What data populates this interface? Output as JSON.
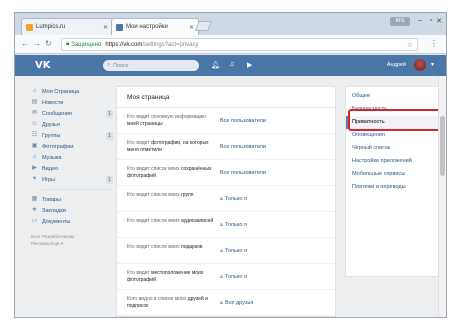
{
  "browser": {
    "tabs": [
      {
        "label": "Lumpics.ru",
        "favicon_color": "#f4a52a"
      },
      {
        "label": "Мои настройки",
        "favicon_color": "#4a76a8"
      }
    ],
    "profile_chip": "ATE",
    "address": {
      "secure_label": "Защищено",
      "host": "https://vk.com",
      "path": "/settings?act=privacy"
    }
  },
  "vk": {
    "logo": "VK",
    "search_placeholder": "Поиск",
    "user_name": "Андрей",
    "accent_color": "#4a76a8"
  },
  "sidebar": {
    "items": [
      {
        "label": "Моя Страница",
        "icon": "home-icon",
        "glyph": "⌂",
        "badge": ""
      },
      {
        "label": "Новости",
        "icon": "news-icon",
        "glyph": "▤",
        "badge": ""
      },
      {
        "label": "Сообщения",
        "icon": "messages-icon",
        "glyph": "✉",
        "badge": "1"
      },
      {
        "label": "Друзья",
        "icon": "friends-icon",
        "glyph": "☺",
        "badge": ""
      },
      {
        "label": "Группы",
        "icon": "groups-icon",
        "glyph": "☷",
        "badge": "1"
      },
      {
        "label": "Фотографии",
        "icon": "photos-icon",
        "glyph": "▣",
        "badge": ""
      },
      {
        "label": "Музыка",
        "icon": "music-icon",
        "glyph": "♫",
        "badge": ""
      },
      {
        "label": "Видео",
        "icon": "video-icon",
        "glyph": "▶",
        "badge": ""
      },
      {
        "label": "Игры",
        "icon": "games-icon",
        "glyph": "✦",
        "badge": "1"
      }
    ],
    "items2": [
      {
        "label": "Товары",
        "icon": "goods-icon",
        "glyph": "▦"
      },
      {
        "label": "Закладки",
        "icon": "bookmarks-icon",
        "glyph": "★"
      },
      {
        "label": "Документы",
        "icon": "documents-icon",
        "glyph": "▭"
      }
    ],
    "footer_line1": "Блог  Разработчикам",
    "footer_line2": "Реклама  Ещё ▾"
  },
  "main": {
    "title": "Моя страница",
    "rows": [
      {
        "q_pre": "Кто видит основную информацию ",
        "q_bold": "моей страницы",
        "answer": "Все пользователи",
        "locked": false
      },
      {
        "q_pre": "Кто видит ",
        "q_bold": "фотографии, на которых меня отметили",
        "answer": "Все пользователи",
        "locked": false
      },
      {
        "q_pre": "Кто видит список моих ",
        "q_bold": "сохранённых фотографий",
        "answer": "Все пользователи",
        "locked": false
      },
      {
        "q_pre": "Кто видит список моих ",
        "q_bold": "групп",
        "answer": "Только я",
        "locked": true
      },
      {
        "q_pre": "Кто видит список моих ",
        "q_bold": "аудиозаписей",
        "answer": "Только я",
        "locked": true
      },
      {
        "q_pre": "Кто видит список моих ",
        "q_bold": "подарков",
        "answer": "Только я",
        "locked": true
      },
      {
        "q_pre": "Кто видит ",
        "q_bold": "местоположение моих фотографий",
        "answer": "Только я",
        "locked": true
      },
      {
        "q_pre": "Кого видно в списке моих ",
        "q_bold": "друзей и подписок",
        "answer": "Все друзья",
        "locked": true
      }
    ]
  },
  "settings_menu": {
    "items": [
      {
        "label": "Общее",
        "active": false
      },
      {
        "label": "Безопасность",
        "active": false
      },
      {
        "label": "Приватность",
        "active": true
      },
      {
        "label": "Оповещения",
        "active": false
      },
      {
        "label": "Чёрный список",
        "active": false
      },
      {
        "label": "Настройки приложений",
        "active": false
      },
      {
        "label": "Мобильные сервисы",
        "active": false
      },
      {
        "label": "Платежи и переводы",
        "active": false
      }
    ]
  },
  "highlight_color": "#d9242c"
}
